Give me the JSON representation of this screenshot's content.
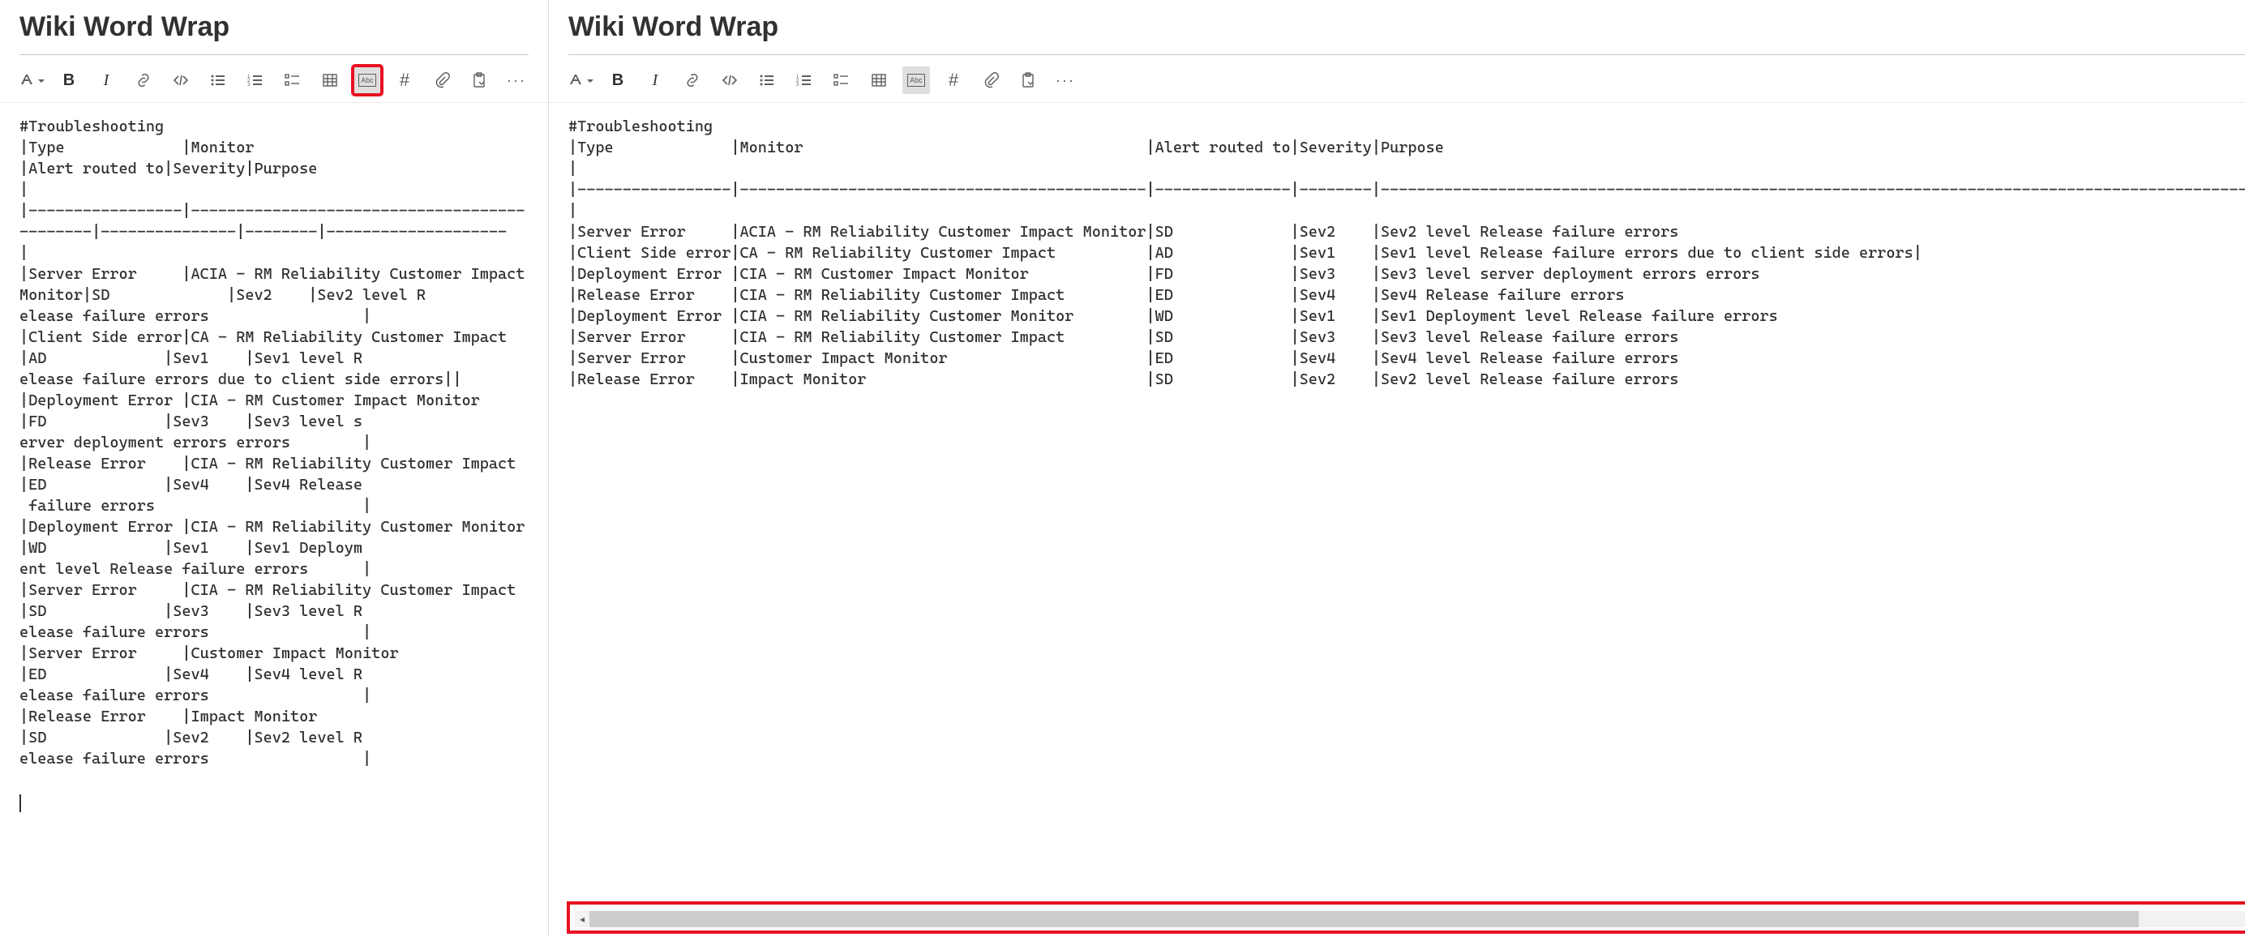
{
  "title": "Wiki Word Wrap",
  "toolbar": {
    "format_label": "Format",
    "bold": "B",
    "italic": "I",
    "link": "Link",
    "code": "</>",
    "ul": "Bulleted list",
    "ol": "Numbered list",
    "checklist": "Checklist",
    "table": "Table",
    "wrap": "Abc",
    "hash": "#",
    "attach": "Attach",
    "paste": "Paste",
    "more": "···"
  },
  "body": {
    "header": "#Troubleshooting",
    "columns": [
      "Type",
      "Monitor",
      "Alert routed to",
      "Severity",
      "Purpose"
    ],
    "rows": [
      {
        "type": "Server Error",
        "monitor": "ACIA - RM Reliability Customer Impact Monitor",
        "routed": "SD",
        "sev": "Sev2",
        "purpose": "Sev2 level Release failure errors"
      },
      {
        "type": "Client Side error",
        "monitor": "CA - RM Reliability Customer Impact",
        "routed": "AD",
        "sev": "Sev1",
        "purpose": "Sev1 level Release failure errors due to client side errors|"
      },
      {
        "type": "Deployment Error",
        "monitor": "CIA - RM Customer Impact Monitor",
        "routed": "FD",
        "sev": "Sev3",
        "purpose": "Sev3 level server deployment errors errors"
      },
      {
        "type": "Release Error",
        "monitor": "CIA - RM Reliability Customer Impact",
        "routed": "ED",
        "sev": "Sev4",
        "purpose": "Sev4 Release failure errors"
      },
      {
        "type": "Deployment Error",
        "monitor": "CIA - RM Reliability Customer Monitor",
        "routed": "WD",
        "sev": "Sev1",
        "purpose": "Sev1 Deployment level Release failure errors"
      },
      {
        "type": "Server Error",
        "monitor": "CIA - RM Reliability Customer Impact",
        "routed": "SD",
        "sev": "Sev3",
        "purpose": "Sev3 level Release failure errors"
      },
      {
        "type": "Server Error",
        "monitor": "Customer Impact Monitor",
        "routed": "ED",
        "sev": "Sev4",
        "purpose": "Sev4 level Release failure errors"
      },
      {
        "type": "Release Error",
        "monitor": "Impact Monitor",
        "routed": "SD",
        "sev": "Sev2",
        "purpose": "Sev2 level Release failure errors"
      }
    ],
    "col_widths": {
      "type": 17,
      "monitor": 45,
      "routed": 15,
      "sev": 8
    }
  }
}
